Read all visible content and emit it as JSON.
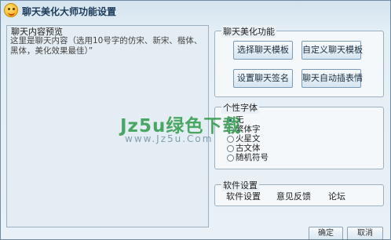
{
  "window": {
    "title": "聊天美化大师功能设置"
  },
  "preview": {
    "label": "聊天内容预览",
    "text": "这里是聊天内容（选用10号字的仿宋、新宋、楷体、黑体，美化效果最佳）”"
  },
  "beautify": {
    "legend": "聊天美化功能",
    "buttons": [
      "选择聊天模板",
      "自定义聊天模板",
      "设置聊天签名",
      "聊天自动插表情"
    ]
  },
  "font": {
    "legend": "个性字体",
    "options": [
      {
        "label": "无",
        "checked": true
      },
      {
        "label": "繁体字",
        "checked": false
      },
      {
        "label": "火星文",
        "checked": false
      },
      {
        "label": "古文体",
        "checked": false
      },
      {
        "label": "随机符号",
        "checked": false
      }
    ]
  },
  "settings": {
    "legend": "软件设置",
    "links": [
      "软件设置",
      "意见反馈",
      "论坛"
    ]
  },
  "footer": {
    "ok_label": "确定",
    "cancel_label": "取消"
  },
  "watermark": {
    "main": "Jz5u绿色下载",
    "sub": "www.Jz5u.Com"
  }
}
